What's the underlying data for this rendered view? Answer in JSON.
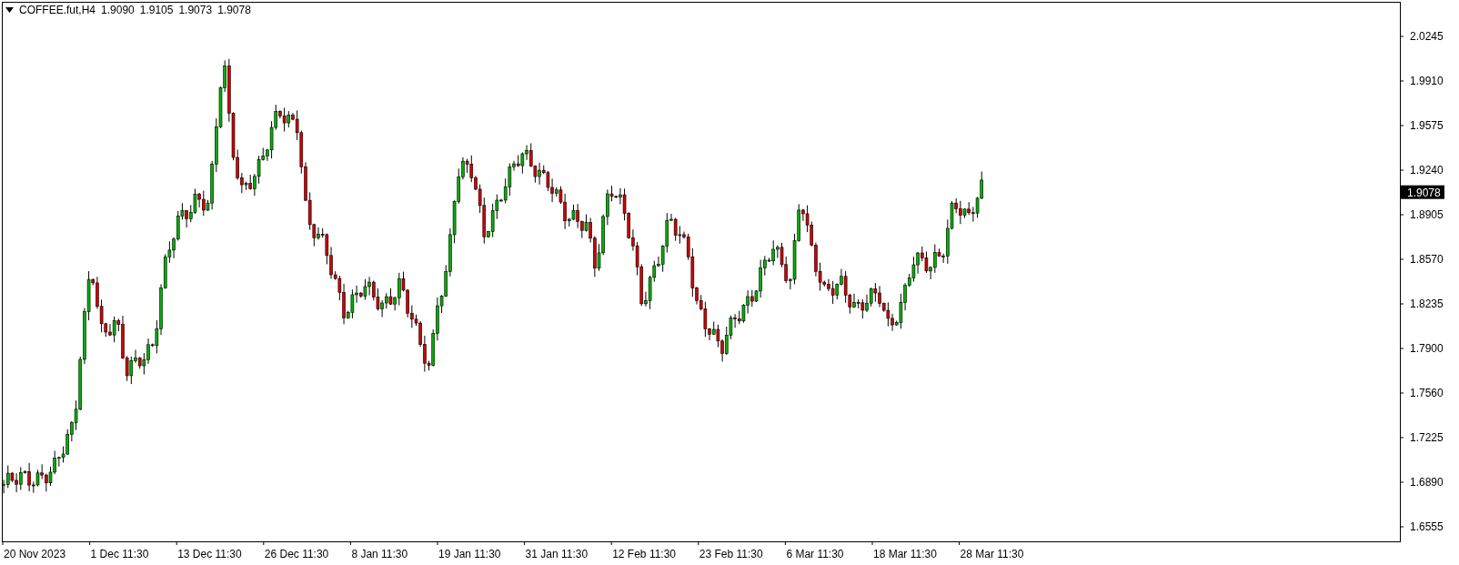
{
  "header": {
    "symbol": "COFFEE.fut,H4",
    "values": [
      "1.9090",
      "1.9105",
      "1.9073",
      "1.9078"
    ]
  },
  "price_axis": {
    "labels": [
      "2.0245",
      "1.9910",
      "1.9575",
      "1.9240",
      "1.8905",
      "1.8570",
      "1.8235",
      "1.7900",
      "1.7560",
      "1.7225",
      "1.6890",
      "1.6555"
    ],
    "current_price": "1.9078"
  },
  "time_axis": {
    "labels": [
      "20 Nov 2023",
      "1 Dec 11:30",
      "13 Dec 11:30",
      "26 Dec 11:30",
      "8 Jan 11:30",
      "19 Jan 11:30",
      "31 Jan 11:30",
      "12 Feb 11:30",
      "23 Feb 11:30",
      "6 Mar 11:30",
      "18 Mar 11:30",
      "28 Mar 11:30"
    ]
  }
}
